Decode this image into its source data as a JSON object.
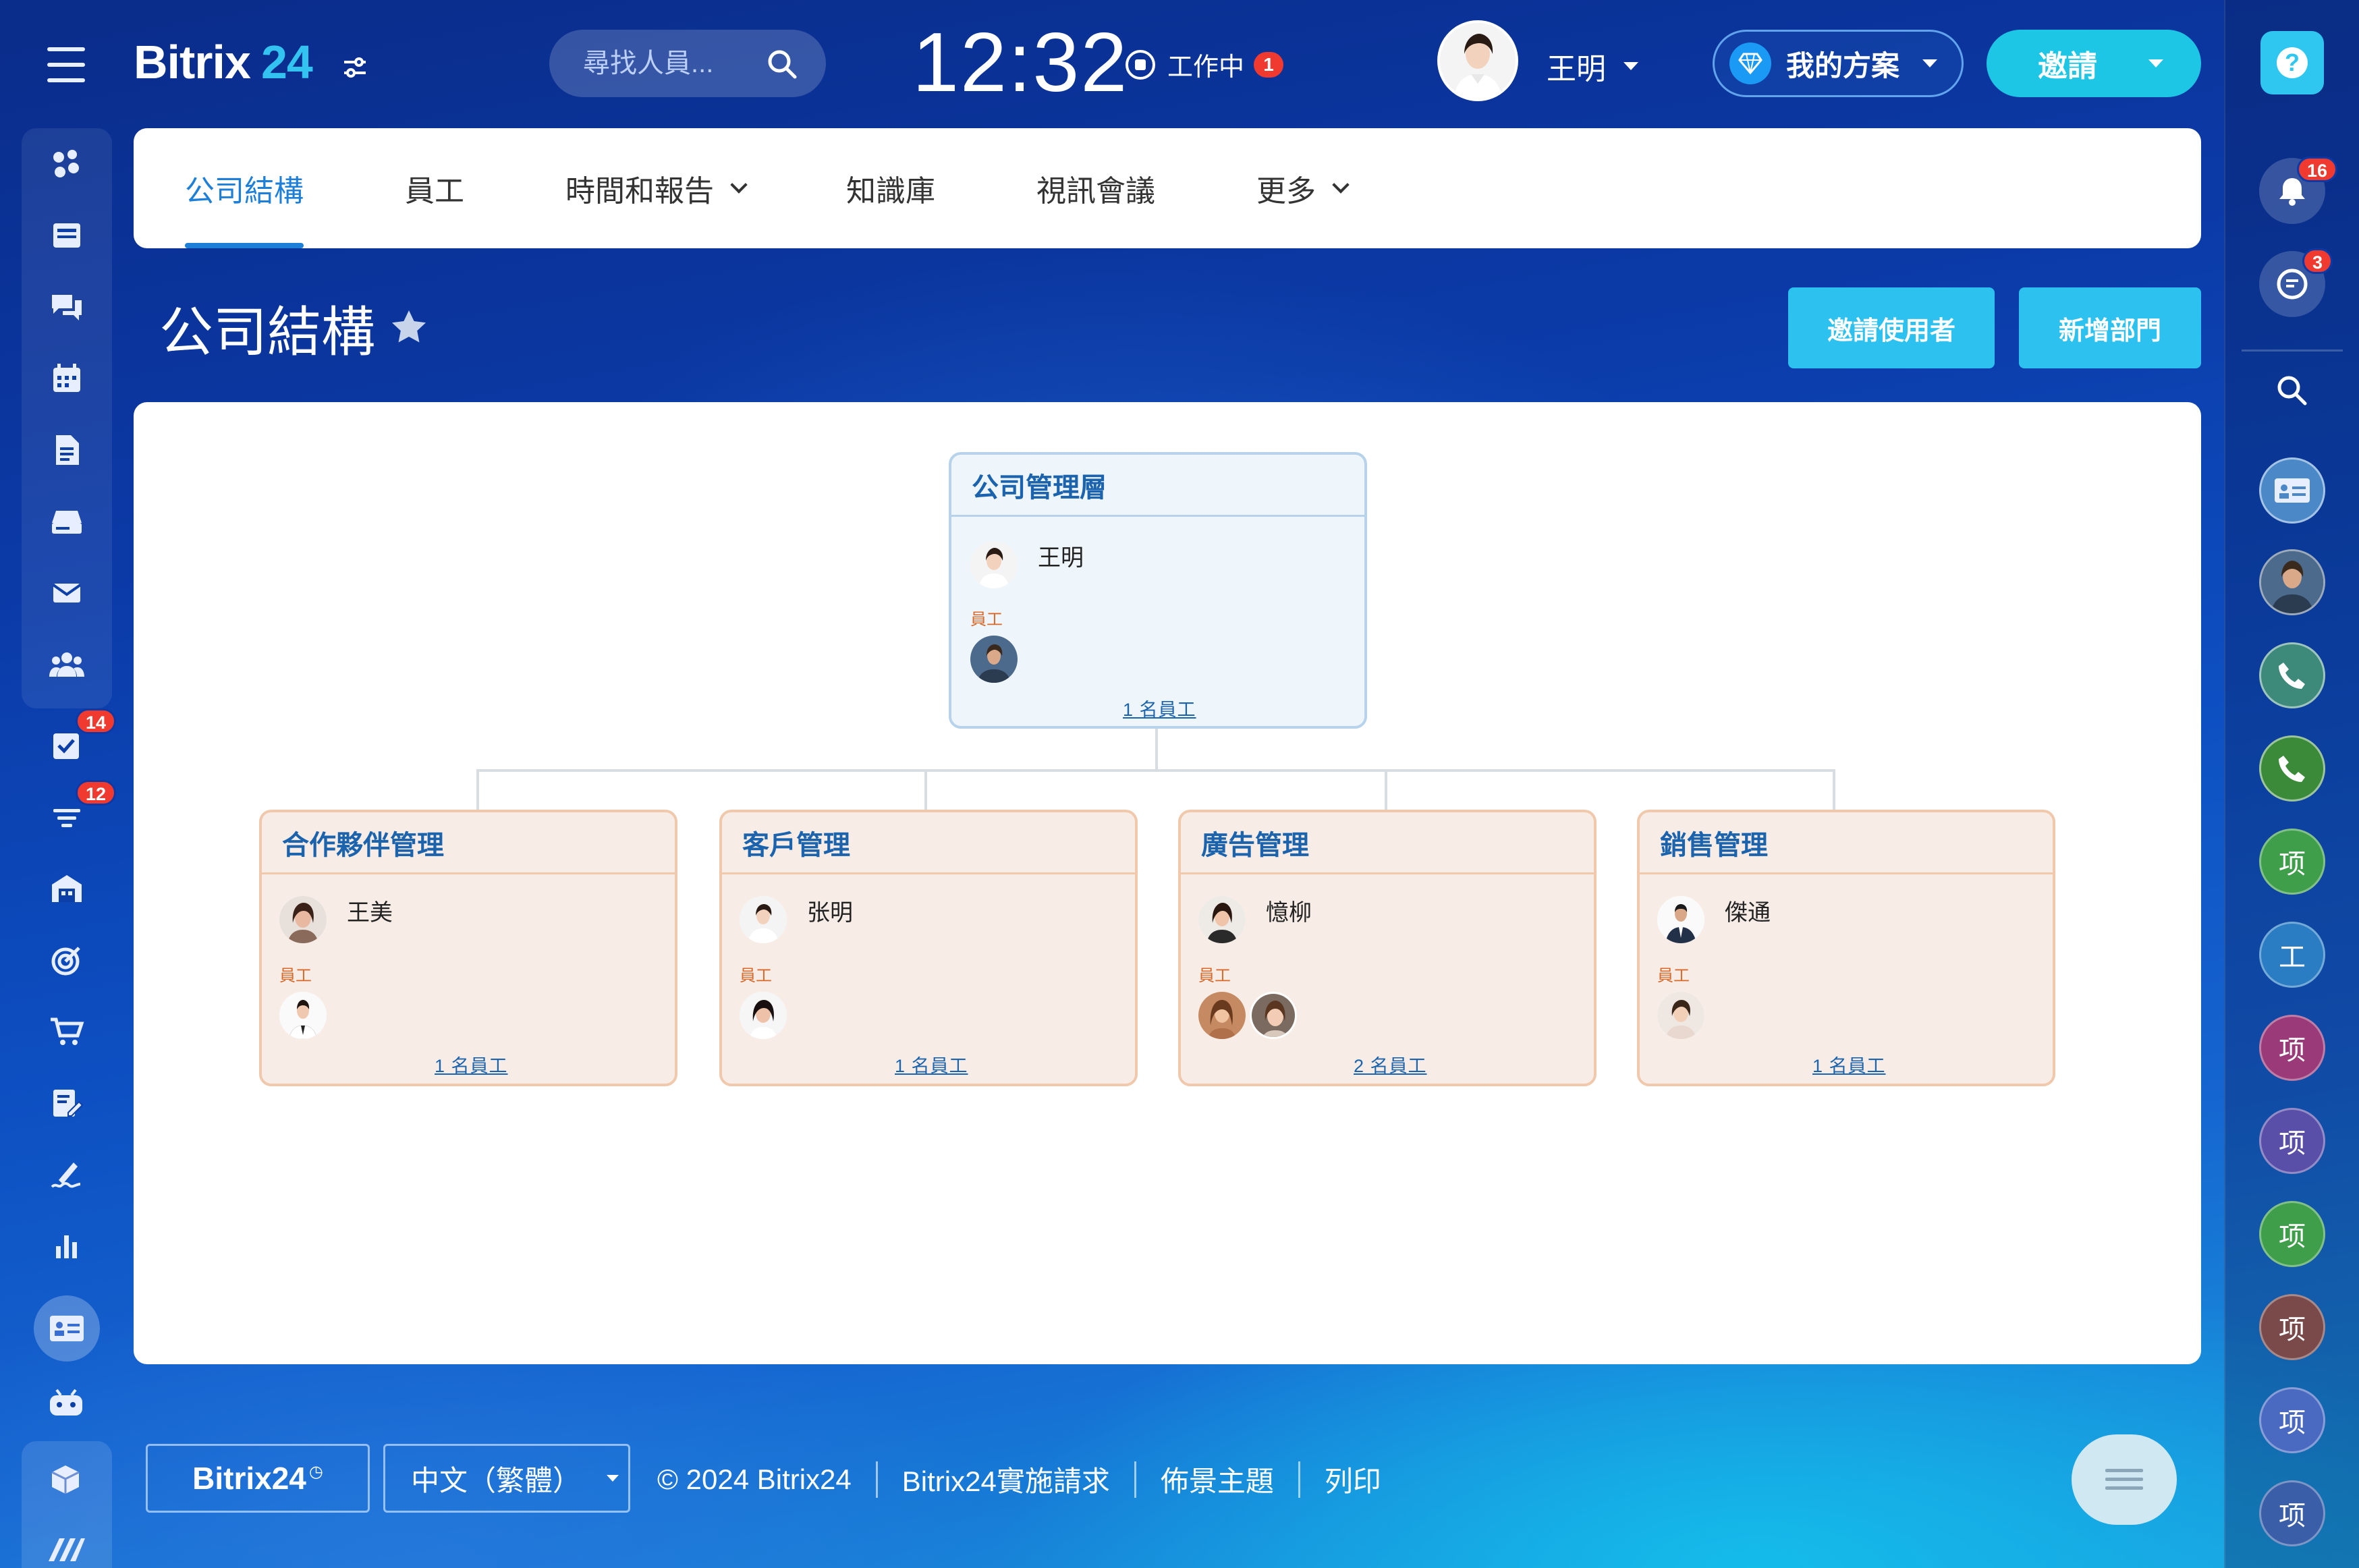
{
  "app": {
    "logo_text": "Bitrix",
    "logo_num": "24",
    "search_placeholder": "尋找人員...",
    "clock": "12:32",
    "workday_label": "工作中",
    "workday_badge": "1",
    "user_name": "王明",
    "plan_label": "我的方案",
    "invite_label": "邀請"
  },
  "left_badges": {
    "tasks": "14",
    "crm": "12"
  },
  "nav": {
    "tabs": [
      "公司結構",
      "員工",
      "時間和報告",
      "知識庫",
      "視訊會議",
      "更多"
    ],
    "active_index": 0
  },
  "page": {
    "title": "公司結構",
    "invite_users_label": "邀請使用者",
    "add_department_label": "新增部門"
  },
  "org": {
    "employee_label": "員工",
    "root": {
      "name": "公司管理層",
      "head": "王明",
      "count_link": "1 名員工"
    },
    "departments": [
      {
        "name": "合作夥伴管理",
        "head": "王美",
        "count_link": "1 名員工"
      },
      {
        "name": "客戶管理",
        "head": "张明",
        "count_link": "1 名員工"
      },
      {
        "name": "廣告管理",
        "head": "憶柳",
        "count_link": "2 名員工"
      },
      {
        "name": "銷售管理",
        "head": "傑通",
        "count_link": "1 名員工"
      }
    ]
  },
  "right_rail": {
    "notifications_badge": "16",
    "chats_badge": "3",
    "items": [
      "项",
      "工",
      "项",
      "项",
      "项",
      "项",
      "项",
      "项"
    ],
    "item_colors": [
      "#3f9e4a",
      "#2a7dc2",
      "#9b3a78",
      "#5a4fa8",
      "#3f9e4a",
      "#7a4a4a",
      "#4a6ac2",
      "#3a5ea8"
    ]
  },
  "footer": {
    "brand": "Bitrix24",
    "language": "中文（繁體）",
    "copyright": "© 2024 Bitrix24",
    "links": [
      "Bitrix24實施請求",
      "佈景主題",
      "列印"
    ]
  }
}
